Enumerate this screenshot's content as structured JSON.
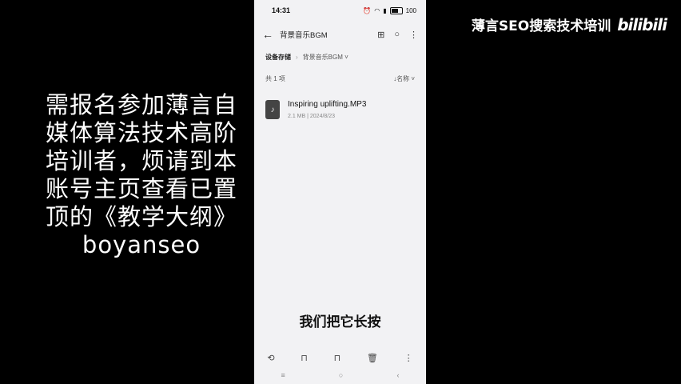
{
  "left_caption": {
    "lines": [
      "需报名参加薄言自",
      "媒体算法技术高阶",
      "培训者，烦请到本",
      "账号主页查看已置",
      "顶的《教学大纲》",
      "boyanseo"
    ]
  },
  "brand": {
    "title": "薄言SEO搜索技术培训",
    "logo": "bilibili"
  },
  "phone": {
    "status": {
      "time": "14:31",
      "battery": "100"
    },
    "appbar": {
      "back": "←",
      "title": "背景音乐BGM"
    },
    "breadcrumb": {
      "root": "设备存储",
      "current": "背景音乐BGM ˅"
    },
    "list": {
      "count": "共 1 项",
      "sort": "↓名称 ˅"
    },
    "file": {
      "name": "Inspiring uplifting.MP3",
      "meta": "2.1 MB  |  2024/8/23"
    },
    "subtitle": "我们把它长按"
  }
}
